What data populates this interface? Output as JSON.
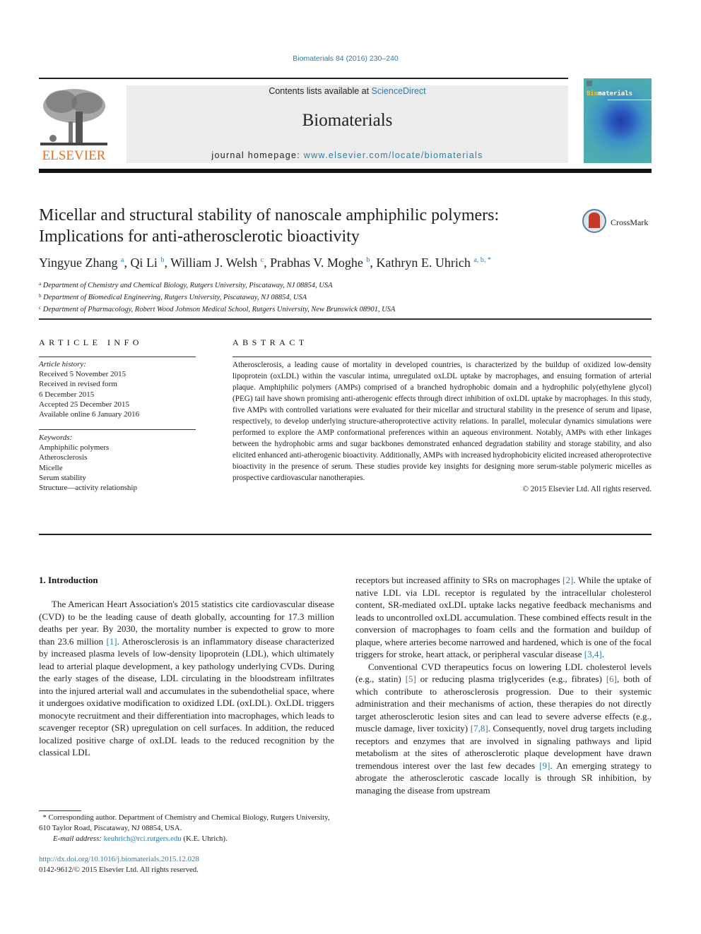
{
  "header": {
    "citation": "Biomaterials 84 (2016) 230–240",
    "publisher_logo_text": "ELSEVIER",
    "contents_prefix": "Contents lists available at ",
    "contents_link": "ScienceDirect",
    "journal_title": "Biomaterials",
    "homepage_prefix": "journal homepage: ",
    "homepage_link": "www.elsevier.com/locate/biomaterials",
    "cover_title_accent": "Bio",
    "cover_title_rest": "materials",
    "colors": {
      "link": "#2b7ea8",
      "elsevier_orange": "#e9711c",
      "banner_bg": "#ececec"
    }
  },
  "article": {
    "title_line1": "Micellar and structural stability of nanoscale amphiphilic polymers:",
    "title_line2": "Implications for anti-atherosclerotic bioactivity",
    "crossmark_label": "CrossMark",
    "authors": [
      {
        "name": "Yingyue Zhang",
        "sup": "a"
      },
      {
        "name": "Qi Li",
        "sup": "b"
      },
      {
        "name": "William J. Welsh",
        "sup": "c"
      },
      {
        "name": "Prabhas V. Moghe",
        "sup": "b"
      },
      {
        "name": "Kathryn E. Uhrich",
        "sup": "a, b, *"
      }
    ],
    "affiliations": [
      {
        "sup": "a",
        "text": "Department of Chemistry and Chemical Biology, Rutgers University, Piscataway, NJ 08854, USA"
      },
      {
        "sup": "b",
        "text": "Department of Biomedical Engineering, Rutgers University, Piscataway, NJ 08854, USA"
      },
      {
        "sup": "c",
        "text": "Department of Pharmacology, Robert Wood Johnson Medical School, Rutgers University, New Brunswick 08901, USA"
      }
    ]
  },
  "article_info": {
    "heading": "ARTICLE INFO",
    "history_label": "Article history:",
    "history": [
      "Received 5 November 2015",
      "Received in revised form",
      "6 December 2015",
      "Accepted 25 December 2015",
      "Available online 6 January 2016"
    ],
    "keywords_label": "Keywords:",
    "keywords": [
      "Amphiphilic polymers",
      "Atherosclerosis",
      "Micelle",
      "Serum stability",
      "Structure—activity relationship"
    ]
  },
  "abstract": {
    "heading": "ABSTRACT",
    "text": "Atherosclerosis, a leading cause of mortality in developed countries, is characterized by the buildup of oxidized low-density lipoprotein (oxLDL) within the vascular intima, unregulated oxLDL uptake by macrophages, and ensuing formation of arterial plaque. Amphiphilic polymers (AMPs) comprised of a branched hydrophobic domain and a hydrophilic poly(ethylene glycol) (PEG) tail have shown promising anti-atherogenic effects through direct inhibition of oxLDL uptake by macrophages. In this study, five AMPs with controlled variations were evaluated for their micellar and structural stability in the presence of serum and lipase, respectively, to develop underlying structure-atheroprotective activity relations. In parallel, molecular dynamics simulations were performed to explore the AMP conformational preferences within an aqueous environment. Notably, AMPs with ether linkages between the hydrophobic arms and sugar backbones demonstrated enhanced degradation stability and storage stability, and also elicited enhanced anti-atherogenic bioactivity. Additionally, AMPs with increased hydrophobicity elicited increased atheroprotective bioactivity in the presence of serum. These studies provide key insights for designing more serum-stable polymeric micelles as prospective cardiovascular nanotherapies.",
    "copyright": "© 2015 Elsevier Ltd. All rights reserved."
  },
  "body": {
    "section_heading": "1.  Introduction",
    "left": {
      "p1_a": "The American Heart Association's 2015 statistics cite cardiovascular disease (CVD) to be the leading cause of death globally, accounting for 17.3 million deaths per year. By 2030, the mortality number is expected to grow to more than 23.6 million ",
      "p1_ref1": "[1]",
      "p1_b": ". Atherosclerosis is an inflammatory disease characterized by increased plasma levels of low-density lipoprotein (LDL), which ultimately lead to arterial plaque development, a key pathology underlying CVDs. During the early stages of the disease, LDL circulating in the bloodstream infiltrates into the injured arterial wall and accumulates in the subendothelial space, where it undergoes oxidative modification to oxidized LDL (oxLDL). OxLDL triggers monocyte recruitment and their differentiation into macrophages, which leads to scavenger receptor (SR) upregulation on cell surfaces. In addition, the reduced localized positive charge of oxLDL leads to the reduced recognition by the classical LDL"
    },
    "right": {
      "p1_a": "receptors but increased affinity to SRs on macrophages ",
      "p1_ref2": "[2]",
      "p1_b": ". While the uptake of native LDL via LDL receptor is regulated by the intracellular cholesterol content, SR-mediated oxLDL uptake lacks negative feedback mechanisms and leads to uncontrolled oxLDL accumulation. These combined effects result in the conversion of macrophages to foam cells and the formation and buildup of plaque, where arteries become narrowed and hardened, which is one of the focal triggers for stroke, heart attack, or peripheral vascular disease ",
      "p1_ref34": "[3,4]",
      "p1_c": ".",
      "p2_a": "Conventional CVD therapeutics focus on lowering LDL cholesterol levels (e.g., statin) ",
      "p2_ref5": "[5]",
      "p2_b": " or reducing plasma triglycerides (e.g., fibrates) ",
      "p2_ref6": "[6]",
      "p2_c": ", both of which contribute to atherosclerosis progression. Due to their systemic administration and their mechanisms of action, these therapies do not directly target atherosclerotic lesion sites and can lead to severe adverse effects (e.g., muscle damage, liver toxicity) ",
      "p2_ref78": "[7,8]",
      "p2_d": ". Consequently, novel drug targets including receptors and enzymes that are involved in signaling pathways and lipid metabolism at the sites of atherosclerotic plaque development have drawn tremendous interest over the last few decades ",
      "p2_ref9": "[9]",
      "p2_e": ". An emerging strategy to abrogate the atherosclerotic cascade locally is through SR inhibition, by managing the disease from upstream"
    }
  },
  "footnote": {
    "corresponding": "* Corresponding author. Department of Chemistry and Chemical Biology, Rutgers University, 610 Taylor Road, Piscataway, NJ 08854, USA.",
    "email_label": "E-mail address: ",
    "email": "keuhrich@rci.rutgers.edu",
    "email_suffix": " (K.E. Uhrich).",
    "doi": "http://dx.doi.org/10.1016/j.biomaterials.2015.12.028",
    "issn_line": "0142-9612/© 2015 Elsevier Ltd. All rights reserved."
  }
}
